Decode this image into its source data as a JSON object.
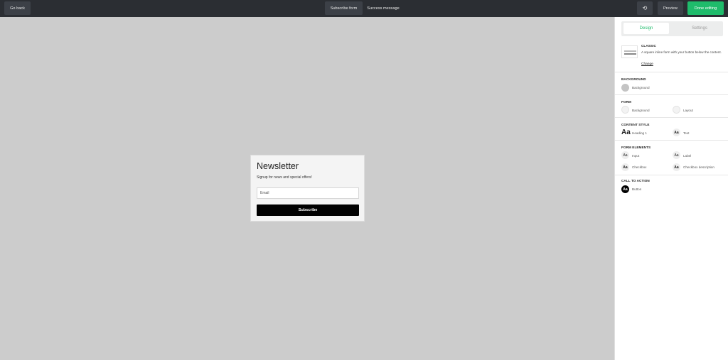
{
  "topbar": {
    "go_back": "Go back",
    "tab_subscribe": "Subscribe form",
    "tab_success": "Success message",
    "undo_icon": "⟲",
    "preview": "Preview",
    "done": "Done editing"
  },
  "card": {
    "title": "Newsletter",
    "subtitle": "Signup for news and special offers!",
    "email_placeholder": "Email",
    "subscribe": "Subscribe"
  },
  "panel": {
    "tab_design": "Design",
    "tab_settings": "Settings",
    "classic_title": "CLASSIC",
    "classic_desc": "A square inline form with your button below the content.",
    "change": "Change",
    "background_title": "BACKGROUND",
    "background_opt": "Background",
    "form_title": "FORM",
    "form_background": "Background",
    "form_layout": "Layout",
    "content_title": "CONTENT STYLE",
    "heading1": "Heading 1",
    "text": "Text",
    "elements_title": "FORM ELEMENTS",
    "input": "Input",
    "label": "Label",
    "checkbox": "Checkbox",
    "checkbox_desc": "Checkbox description",
    "cta_title": "CALL TO ACTION",
    "button": "Button",
    "aa": "Aa"
  },
  "colors": {
    "accent": "#1fbb6b",
    "topbar": "#2b2e33",
    "canvas": "#cccccc"
  }
}
